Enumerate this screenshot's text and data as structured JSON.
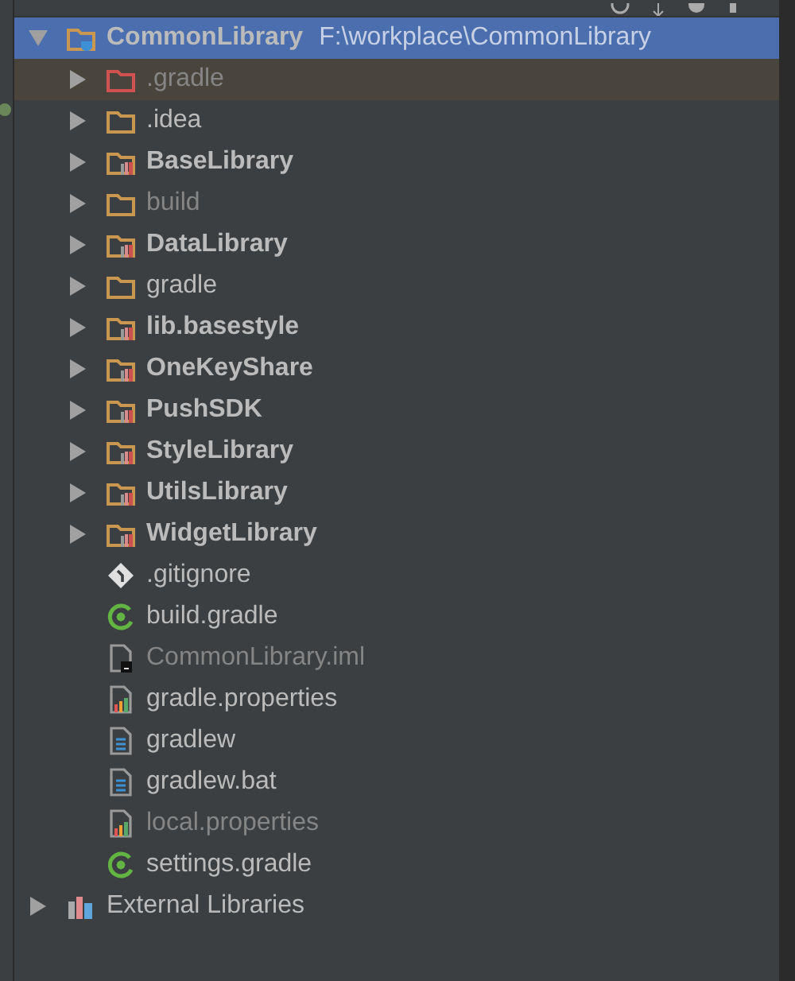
{
  "project_tree": [
    {
      "label": "CommonLibrary",
      "path": "F:\\workplace\\CommonLibrary",
      "kind": "project",
      "expanded": true,
      "selected": true,
      "highlighted": false,
      "dimmed": false,
      "children": [
        {
          "label": ".gradle",
          "kind": "folder-excluded",
          "expanded": false,
          "selected": false,
          "highlighted": true,
          "dimmed": true
        },
        {
          "label": ".idea",
          "kind": "folder",
          "expanded": false,
          "selected": false,
          "highlighted": false,
          "dimmed": false
        },
        {
          "label": "BaseLibrary",
          "kind": "module",
          "expanded": false,
          "selected": false,
          "highlighted": false,
          "dimmed": false
        },
        {
          "label": "build",
          "kind": "folder",
          "expanded": false,
          "selected": false,
          "highlighted": false,
          "dimmed": true
        },
        {
          "label": "DataLibrary",
          "kind": "module",
          "expanded": false,
          "selected": false,
          "highlighted": false,
          "dimmed": false
        },
        {
          "label": "gradle",
          "kind": "folder",
          "expanded": false,
          "selected": false,
          "highlighted": false,
          "dimmed": false
        },
        {
          "label": "lib.basestyle",
          "kind": "module",
          "expanded": false,
          "selected": false,
          "highlighted": false,
          "dimmed": false
        },
        {
          "label": "OneKeyShare",
          "kind": "module",
          "expanded": false,
          "selected": false,
          "highlighted": false,
          "dimmed": false
        },
        {
          "label": "PushSDK",
          "kind": "module",
          "expanded": false,
          "selected": false,
          "highlighted": false,
          "dimmed": false
        },
        {
          "label": "StyleLibrary",
          "kind": "module",
          "expanded": false,
          "selected": false,
          "highlighted": false,
          "dimmed": false
        },
        {
          "label": "UtilsLibrary",
          "kind": "module",
          "expanded": false,
          "selected": false,
          "highlighted": false,
          "dimmed": false
        },
        {
          "label": "WidgetLibrary",
          "kind": "module",
          "expanded": false,
          "selected": false,
          "highlighted": false,
          "dimmed": false
        },
        {
          "label": ".gitignore",
          "kind": "git",
          "selected": false,
          "highlighted": false,
          "dimmed": false
        },
        {
          "label": "build.gradle",
          "kind": "gradle",
          "selected": false,
          "highlighted": false,
          "dimmed": false
        },
        {
          "label": "CommonLibrary.iml",
          "kind": "iml",
          "selected": false,
          "highlighted": false,
          "dimmed": true
        },
        {
          "label": "gradle.properties",
          "kind": "properties",
          "selected": false,
          "highlighted": false,
          "dimmed": false
        },
        {
          "label": "gradlew",
          "kind": "text",
          "selected": false,
          "highlighted": false,
          "dimmed": false
        },
        {
          "label": "gradlew.bat",
          "kind": "text",
          "selected": false,
          "highlighted": false,
          "dimmed": false
        },
        {
          "label": "local.properties",
          "kind": "properties",
          "selected": false,
          "highlighted": false,
          "dimmed": true
        },
        {
          "label": "settings.gradle",
          "kind": "gradle",
          "selected": false,
          "highlighted": false,
          "dimmed": false
        }
      ]
    },
    {
      "label": "External Libraries",
      "kind": "libraries",
      "expanded": false,
      "selected": false,
      "highlighted": false,
      "dimmed": false
    }
  ]
}
